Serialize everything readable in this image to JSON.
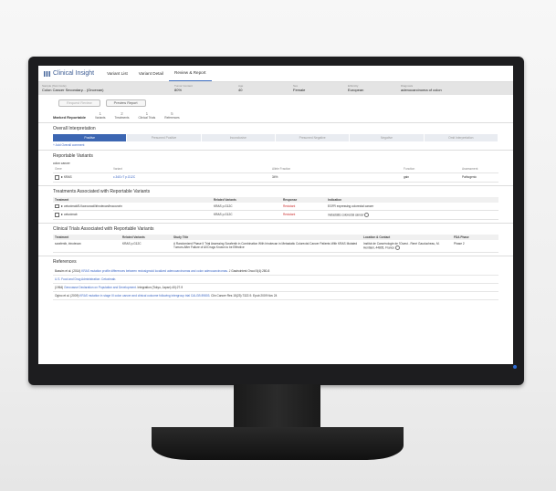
{
  "app": {
    "title": "Clinical Insight"
  },
  "nav": [
    {
      "label": "Variant List"
    },
    {
      "label": "Variant Detail"
    },
    {
      "label": "Review & Report"
    }
  ],
  "patient": [
    {
      "label": "Sample (Test Code)",
      "value": "Colon Cancer Secondary... (Oncexan)"
    },
    {
      "label": "Tumor Content",
      "value": "80%"
    },
    {
      "label": "Age",
      "value": "40"
    },
    {
      "label": "Sex",
      "value": "Female"
    },
    {
      "label": "Ethnicity",
      "value": "European"
    },
    {
      "label": "Diagnosis",
      "value": "adenocarcinoma of colon"
    }
  ],
  "actions": {
    "request_review": "Request Review",
    "preview_report": "Preview Report"
  },
  "steps": {
    "label": "Marked Reportable",
    "items": [
      {
        "num": "1",
        "label": "Variants"
      },
      {
        "num": "2",
        "label": "Treatments"
      },
      {
        "num": "1",
        "label": "Clinical Trials"
      },
      {
        "num": "5",
        "label": "References"
      }
    ]
  },
  "interpretation": {
    "title": "Overall Interpretation",
    "options": [
      "Positive",
      "Presumed Positive",
      "Inconclusive",
      "Presumed Negative",
      "Negative",
      "Omit Interpretation"
    ],
    "add_comment": "Add Overall comment"
  },
  "reportable": {
    "title": "Reportable Variants",
    "group": "colon cancer",
    "headers": {
      "gene": "Gene",
      "variant": "Variant",
      "allele": "Allele Fraction",
      "function": "Function",
      "assessment": "Assessment"
    },
    "rows": [
      {
        "gene": "KRAS",
        "variant": "c.34G>T p.G12C",
        "allele": "34%",
        "function": "gain",
        "assessment": "Pathogenic"
      }
    ]
  },
  "treatments": {
    "title": "Treatments Associated with Reportable Variants",
    "headers": {
      "treatment": "Treatment",
      "related": "Related Variants",
      "response": "Response",
      "indication": "Indication"
    },
    "rows": [
      {
        "treatment": "cetuximab/5-fluorouracil/irinotecan/leucovorin",
        "related": "KRAS p.G12C",
        "response": "Resistant",
        "indication": "EGFR expressing colorectal cancer"
      },
      {
        "treatment": "cetuximab",
        "related": "KRAS p.G12C",
        "response": "Resistant",
        "indication": "metastatic colorectal cancer"
      }
    ]
  },
  "trials": {
    "title": "Clinical Trials Associated with Reportable Variants",
    "headers": {
      "treatment": "Treatment",
      "related": "Related Variants",
      "study": "Study Title",
      "location": "Location & Contact",
      "phase": "FDA Phase"
    },
    "rows": [
      {
        "treatment": "sorafenib, irinotecan",
        "related": "KRAS p.G12C",
        "study": "A Randomized Phase II Trial Assessing Sorafenib in Combination With Irinotecan in Metastatic Colorectal Cancer Patients With KRAS Mutated Tumors After Failure of All Drugs Known to be Effective",
        "location": "Institut de Cancérologie de l'Ouest - René Gauducheau, M. Hentiani, 44805, France",
        "phase": "Phase 2"
      }
    ]
  },
  "references": {
    "title": "References",
    "items": [
      {
        "pre": "Bassim et al. (2014) ",
        "link": "KRAS mutation profile differences between rectosigmoid localized adenocarcinomas and colon adenocarcinomas.",
        "post": " J Gastrointest Oncol 5(4):280-8"
      },
      {
        "pre": "",
        "link": "U.S. Food and Drug Administration: Cetuximab.",
        "post": ""
      },
      {
        "pre": "(1964) ",
        "link": "Gerovasse Declaration on Population and Development.",
        "post": " Integration (Tokyo, Japan) 40):27-9"
      },
      {
        "pre": "Ogino et al. (2009) ",
        "link": "KRAS mutation in stage III colon cancer and clinical outcome following intergroup trial CALGB 89803.",
        "post": " Clin Cancer Res 15(23):7322-9. Epub 2009 Nov 24"
      }
    ]
  }
}
